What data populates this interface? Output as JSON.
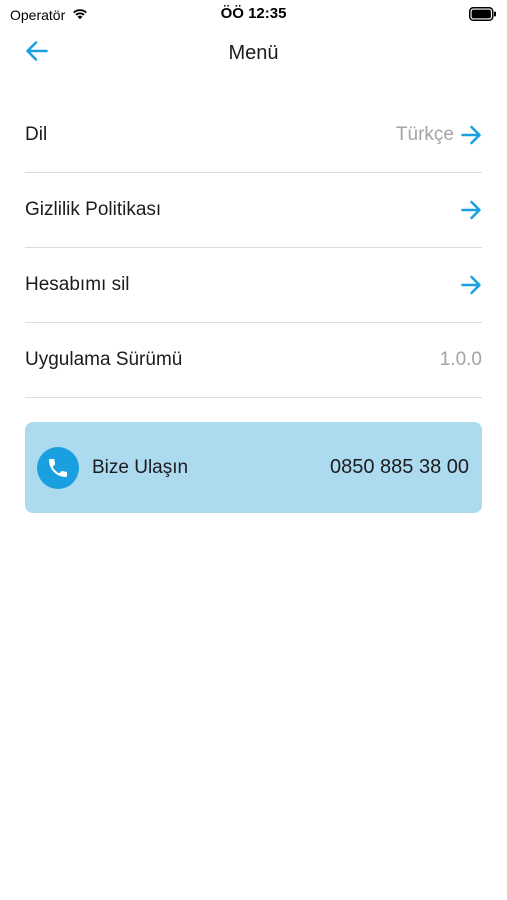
{
  "status_bar": {
    "carrier": "Operatör",
    "time": "ÖÖ 12:35",
    "wifi_icon": "wifi-icon",
    "battery_icon": "battery-icon"
  },
  "nav": {
    "title": "Menü",
    "back_icon": "arrow-left-icon"
  },
  "menu": {
    "items": [
      {
        "label": "Dil",
        "value": "Türkçe",
        "has_arrow": true
      },
      {
        "label": "Gizlilik Politikası",
        "value": "",
        "has_arrow": true
      },
      {
        "label": "Hesabımı sil",
        "value": "",
        "has_arrow": true
      },
      {
        "label": "Uygulama Sürümü",
        "value": "1.0.0",
        "has_arrow": false
      }
    ]
  },
  "contact": {
    "label": "Bize Ulaşın",
    "phone": "0850 885 38 00",
    "icon": "phone-icon"
  },
  "colors": {
    "accent": "#1a9fe0",
    "card_bg": "#acdaef",
    "divider": "#dcdcdc",
    "muted_text": "#a3a3a8"
  }
}
